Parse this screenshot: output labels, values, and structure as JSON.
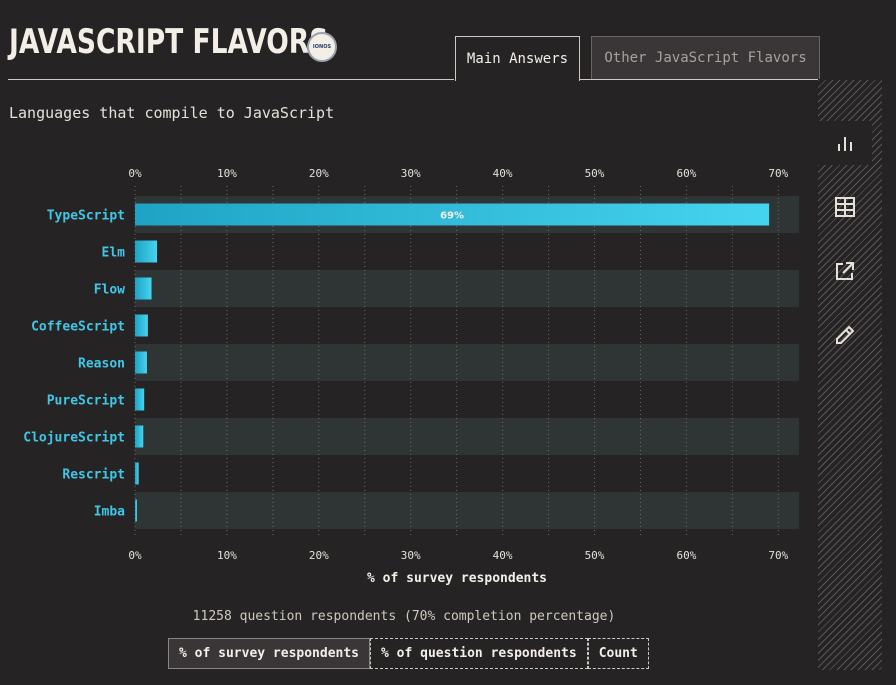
{
  "header": {
    "title": "JAVASCRIPT FLAVORS",
    "sponsor_label": "IONOS"
  },
  "tabs": [
    {
      "label": "Main Answers",
      "active": true
    },
    {
      "label": "Other JavaScript Flavors",
      "active": false
    }
  ],
  "subtitle": "Languages that compile to JavaScript",
  "sidebar": {
    "items": [
      {
        "icon": "bar-chart-icon",
        "active": true
      },
      {
        "icon": "table-icon",
        "active": false
      },
      {
        "icon": "share-icon",
        "active": false
      },
      {
        "icon": "pencil-icon",
        "active": false
      }
    ]
  },
  "chart_data": {
    "type": "bar",
    "orientation": "horizontal",
    "categories": [
      "TypeScript",
      "Elm",
      "Flow",
      "CoffeeScript",
      "Reason",
      "PureScript",
      "ClojureScript",
      "Rescript",
      "Imba"
    ],
    "values": [
      69,
      2.4,
      1.8,
      1.4,
      1.3,
      1.0,
      0.9,
      0.4,
      0.2
    ],
    "data_labels": [
      "69%",
      "",
      "",
      "",
      "",
      "",
      "",
      "",
      ""
    ],
    "xlabel": "% of survey respondents",
    "ylabel": "",
    "xlim": [
      0,
      72
    ],
    "ticks": [
      0,
      10,
      20,
      30,
      40,
      50,
      60,
      70
    ],
    "tick_labels": [
      "0%",
      "10%",
      "20%",
      "30%",
      "40%",
      "50%",
      "60%",
      "70%"
    ],
    "grid": true,
    "colors": {
      "bar_start": "#1fa3c4",
      "bar_end": "#45d4ef",
      "label": "#3fc7e6",
      "band": "#2f3435"
    }
  },
  "footer": {
    "respondents": "11258 question respondents (70% completion percentage)",
    "units": [
      {
        "label": "% of survey respondents",
        "active": true
      },
      {
        "label": "% of question respondents",
        "active": false
      },
      {
        "label": "Count",
        "active": false
      }
    ]
  }
}
